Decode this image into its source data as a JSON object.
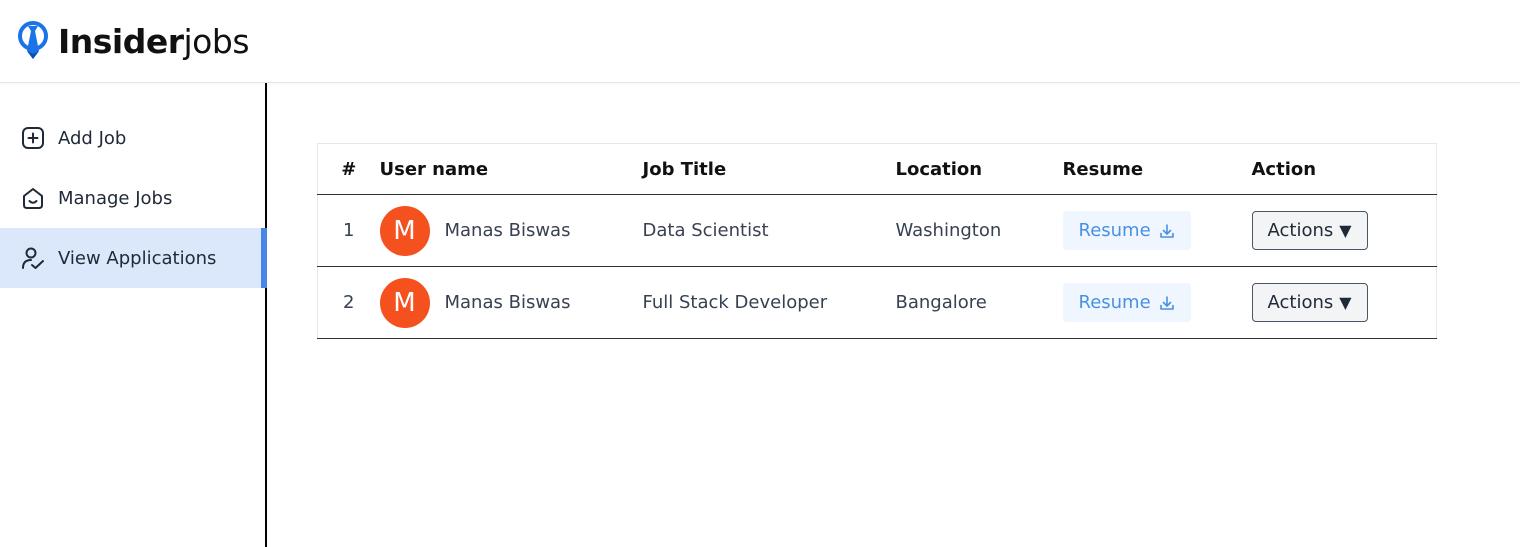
{
  "brand": {
    "bold": "Insider",
    "light": "jobs",
    "accent": "#1a73e8"
  },
  "sidebar": {
    "items": [
      {
        "label": "Add Job",
        "icon": "add-square-icon",
        "active": false
      },
      {
        "label": "Manage Jobs",
        "icon": "briefcase-home-icon",
        "active": false
      },
      {
        "label": "View Applications",
        "icon": "user-check-icon",
        "active": true
      }
    ],
    "active_bg": "#dbe8fb",
    "active_border": "#4a86e8"
  },
  "table": {
    "headers": {
      "num": "#",
      "user": "User name",
      "job": "Job Title",
      "location": "Location",
      "resume": "Resume",
      "action": "Action"
    },
    "rows": [
      {
        "num": "1",
        "avatar": "M",
        "user": "Manas Biswas",
        "job": "Data Scientist",
        "location": "Washington",
        "resume": "Resume",
        "action": "Actions"
      },
      {
        "num": "2",
        "avatar": "M",
        "user": "Manas Biswas",
        "job": "Full Stack Developer",
        "location": "Bangalore",
        "resume": "Resume",
        "action": "Actions"
      }
    ],
    "avatar_color": "#f4511e",
    "resume_color": "#4a90e2"
  }
}
